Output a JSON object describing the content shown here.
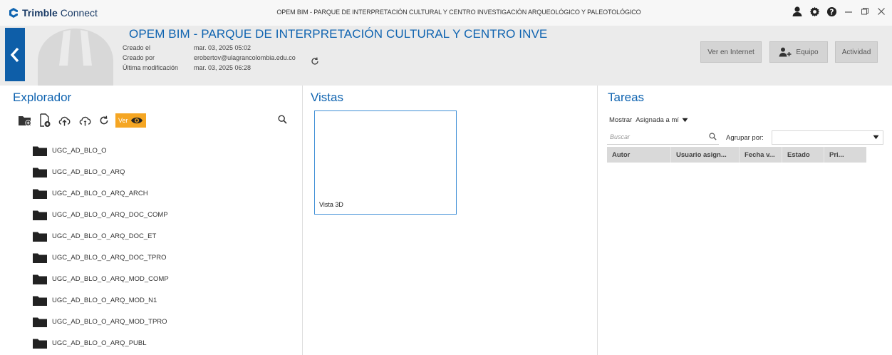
{
  "app": {
    "brand": "Trimble",
    "product": "Connect",
    "window_title": "OPEM BIM - PARQUE DE INTERPRETACIÓN CULTURAL Y CENTRO INVESTIGACIÓN ARQUEOLÓGICO Y PALEOTOLÓGICO"
  },
  "titlebar_icons": [
    "user-icon",
    "gear-icon",
    "help-icon",
    "minimize-icon",
    "restore-icon",
    "close-icon"
  ],
  "project": {
    "title": "OPEM BIM - PARQUE DE INTERPRETACIÓN CULTURAL Y CENTRO INVE",
    "meta": [
      {
        "label": "Creado el",
        "value": "mar. 03, 2025 05:02"
      },
      {
        "label": "Creado por",
        "value": "erobertov@ulagrancolombia.edu.co"
      },
      {
        "label": "Última modificación",
        "value": "mar. 03, 2025 06:28"
      }
    ],
    "buttons": {
      "web": "Ver en Internet",
      "team": "Equipo",
      "activity": "Actividad"
    }
  },
  "explorer": {
    "title": "Explorador",
    "ver_label": "Ver",
    "folders": [
      "UGC_AD_BLO_O",
      "UGC_AD_BLO_O_ARQ",
      "UGC_AD_BLO_O_ARQ_ARCH",
      "UGC_AD_BLO_O_ARQ_DOC_COMP",
      "UGC_AD_BLO_O_ARQ_DOC_ET",
      "UGC_AD_BLO_O_ARQ_DOC_TPRO",
      "UGC_AD_BLO_O_ARQ_MOD_COMP",
      "UGC_AD_BLO_O_ARQ_MOD_N1",
      "UGC_AD_BLO_O_ARQ_MOD_TPRO",
      "UGC_AD_BLO_O_ARQ_PUBL"
    ]
  },
  "views": {
    "title": "Vistas",
    "items": [
      {
        "label": "Vista 3D"
      }
    ]
  },
  "tasks": {
    "title": "Tareas",
    "show_label": "Mostrar",
    "show_value": "Asignada a mí",
    "search_placeholder": "Buscar",
    "group_label": "Agrupar por:",
    "group_value": "",
    "columns": [
      "Autor",
      "Usuario asign...",
      "Fecha v...",
      "Estado",
      "Pri..."
    ]
  },
  "colors": {
    "accent_blue": "#0e63b0",
    "back_button": "#0e5ea8",
    "ver_chip": "#f5a623",
    "view_border": "#3f8fd6"
  }
}
